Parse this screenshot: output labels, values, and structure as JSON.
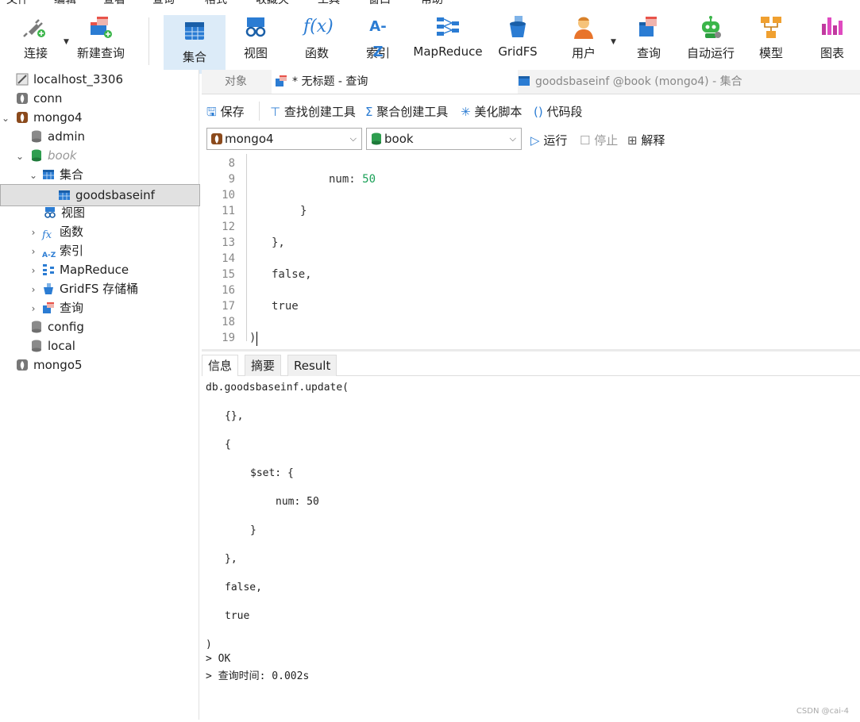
{
  "menu": [
    "文件",
    "编辑",
    "查看",
    "查询",
    "格式",
    "收藏夹",
    "工具",
    "窗口",
    "帮助"
  ],
  "toolbar": {
    "connect": "连接",
    "new_query": "新建查询",
    "collection": "集合",
    "view": "视图",
    "function": "函数",
    "index": "索引",
    "mapreduce": "MapReduce",
    "gridfs": "GridFS",
    "user": "用户",
    "query": "查询",
    "auto_run": "自动运行",
    "model": "模型",
    "chart": "图表",
    "index_icon_text": "A-Z",
    "function_icon_text": "f(x)"
  },
  "sidebar": {
    "localhost": "localhost_3306",
    "conn": "conn",
    "mongo4": "mongo4",
    "admin": "admin",
    "book": "book",
    "collections": "集合",
    "goodsbaseinf": "goodsbaseinf",
    "views": "视图",
    "functions": "函数",
    "indexes": "索引",
    "mapreduce": "MapReduce",
    "gridfs": "GridFS 存储桶",
    "queries": "查询",
    "config": "config",
    "local": "local",
    "mongo5": "mongo5",
    "az": "A-Z",
    "fx": "fx"
  },
  "tabs": {
    "objects": "对象",
    "query": "* 无标题 - 查询",
    "collection": "goodsbaseinf @book (mongo4) - 集合"
  },
  "editor_toolbar": {
    "save": "保存",
    "find_builder": "查找创建工具",
    "aggregate_builder": "聚合创建工具",
    "beautify": "美化脚本",
    "snippet": "代码段"
  },
  "selectors": {
    "connection": "mongo4",
    "database": "book",
    "run": "运行",
    "stop": "停止",
    "explain": "解释"
  },
  "editor": {
    "line_numbers": [
      "8",
      "9",
      "10",
      "11",
      "12",
      "13",
      "14",
      "15",
      "16",
      "17",
      "18",
      "19"
    ],
    "line9_key": "num: ",
    "line9_value": "50",
    "line11": "}",
    "line13": "},",
    "line15": "false,",
    "line17": "true",
    "line19": ")"
  },
  "result": {
    "tabs": [
      "信息",
      "摘要",
      "Result"
    ],
    "lines": [
      "db.goodsbaseinf.update(",
      "{},",
      "{",
      "$set: {",
      "num: 50",
      "}",
      "},",
      "false,",
      "true",
      ")",
      "> OK",
      "> 查询时间: 0.002s"
    ]
  },
  "watermark": "CSDN @cai-4",
  "colors": {
    "accent_blue": "#2b7cd3",
    "active_toolbar_bg": "#dcebf8",
    "selected_tree_bg": "#e1e1e1",
    "number_green": "#1aa057",
    "mongo_brown": "#8b4a1c",
    "db_green": "#2e9e4f"
  }
}
